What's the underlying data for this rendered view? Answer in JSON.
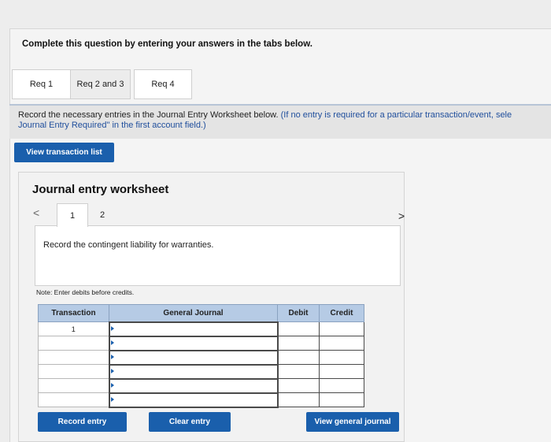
{
  "heading": "Complete this question by entering your answers in the tabs below.",
  "tabs": [
    {
      "label": "Req 1"
    },
    {
      "label": "Req 2 and 3"
    },
    {
      "label": "Req 4"
    }
  ],
  "instruction": {
    "line1_plain": "Record the necessary entries in the Journal Entry Worksheet below. ",
    "line1_blue": "(If no entry is required for a particular transaction/event, sele",
    "line2_blue": "Journal Entry Required\" in the first account field.)"
  },
  "view_transaction_list_label": "View transaction list",
  "worksheet": {
    "title": "Journal entry worksheet",
    "prev_glyph": "<",
    "next_glyph": ">",
    "page_tabs": [
      "1",
      "2"
    ],
    "record_text": "Record the contingent liability for warranties.",
    "note": "Note: Enter debits before credits.",
    "columns": [
      "Transaction",
      "General Journal",
      "Debit",
      "Credit"
    ],
    "rows": [
      {
        "transaction": "1",
        "general_journal": "",
        "debit": "",
        "credit": ""
      },
      {
        "transaction": "",
        "general_journal": "",
        "debit": "",
        "credit": ""
      },
      {
        "transaction": "",
        "general_journal": "",
        "debit": "",
        "credit": ""
      },
      {
        "transaction": "",
        "general_journal": "",
        "debit": "",
        "credit": ""
      },
      {
        "transaction": "",
        "general_journal": "",
        "debit": "",
        "credit": ""
      },
      {
        "transaction": "",
        "general_journal": "",
        "debit": "",
        "credit": ""
      }
    ]
  },
  "buttons": {
    "record_entry": "Record entry",
    "clear_entry": "Clear entry",
    "view_general_journal": "View general journal"
  },
  "colors": {
    "button_blue": "#1a5fac",
    "header_blue": "#b6cbe5",
    "instruction_blue": "#1f4e9c"
  }
}
